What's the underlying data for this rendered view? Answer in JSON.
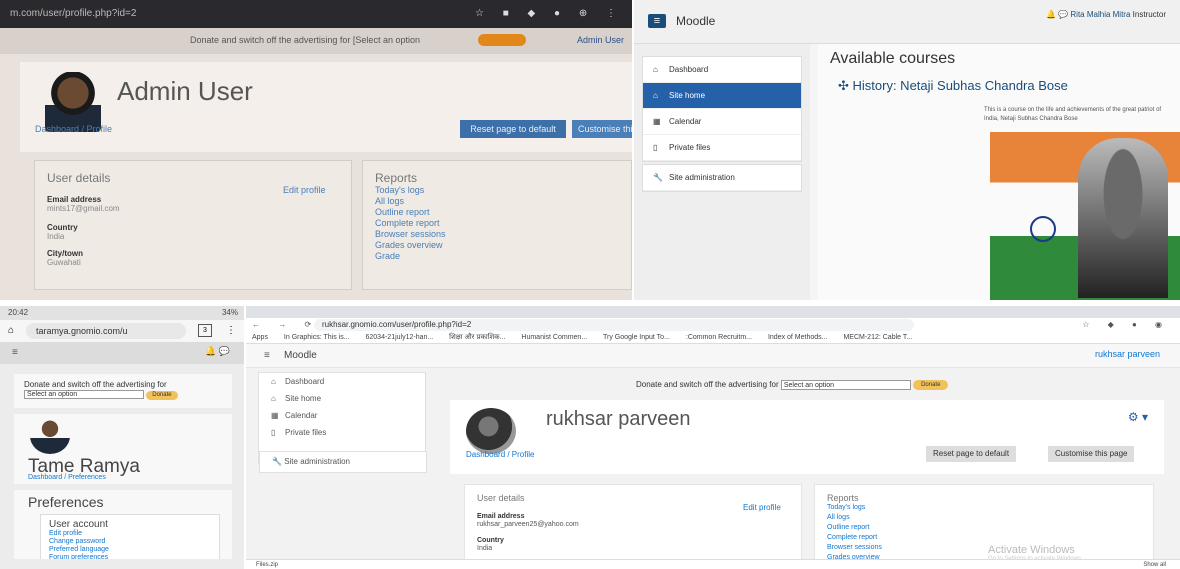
{
  "panel1": {
    "url": "m.com/user/profile.php?id=2",
    "toolbar_icons": "☆ ■ ◆ ● ⊕ ⋮",
    "donate_text": "Donate and switch off the advertising for [Select an option",
    "admin_link": "Admin User",
    "user_name": "Admin User",
    "breadcrumb": "Dashboard / Profile",
    "reset_button": "Reset page to default",
    "customise_button": "Customise this page",
    "details_heading": "User details",
    "edit_profile": "Edit profile",
    "fields": [
      {
        "label": "Email address",
        "value": "mints17@gmail.com"
      },
      {
        "label": "Country",
        "value": "India"
      },
      {
        "label": "City/town",
        "value": "Guwahati"
      }
    ],
    "reports_heading": "Reports",
    "reports": [
      "Today's logs",
      "All logs",
      "Outline report",
      "Complete report",
      "Browser sessions",
      "Grades overview",
      "Grade"
    ]
  },
  "panel2": {
    "brand": "Moodle",
    "user_name": "Rita Malhia Mitra",
    "user_role": "Instructor",
    "nav": [
      {
        "icon": "⌂",
        "label": "Dashboard",
        "active": false
      },
      {
        "icon": "⌂",
        "label": "Site home",
        "active": true
      },
      {
        "icon": "▦",
        "label": "Calendar",
        "active": false
      },
      {
        "icon": "▯",
        "label": "Private files",
        "active": false
      }
    ],
    "site_admin": "Site administration",
    "heading": "Available courses",
    "course_title": "History: Netaji Subhas Chandra Bose",
    "course_summary": "This is a course on the life and achievements of the great patriot of India, Netaji Subhas Chandra Bose"
  },
  "panel3": {
    "time": "20:42",
    "status_right": "34%",
    "url": "taramya.gnomio.com/u",
    "tab_count": "3",
    "donate_text": "Donate and switch off the advertising for",
    "select_option": "Select an option",
    "donate_button": "Donate",
    "user_name": "Tame Ramya",
    "breadcrumb": "Dashboard / Preferences",
    "prefs_heading": "Preferences",
    "account_heading": "User account",
    "links": [
      "Edit profile",
      "Change password",
      "Preferred language",
      "Forum preferences"
    ]
  },
  "panel4": {
    "url": "rukhsar.gnomio.com/user/profile.php?id=2",
    "bookmarks": [
      "Apps",
      "In Graphics: This is...",
      "62034-21july12-han...",
      "शिक्षा और प्रकाशिक...",
      "Humanist Commen...",
      "Try Google Input To...",
      ":Common Recruitm...",
      "Index of Methods...",
      "MECM-212: Cable T..."
    ],
    "brand": "Moodle",
    "user_name": "rukhsar parveen",
    "nav": [
      {
        "icon": "⌂",
        "label": "Dashboard"
      },
      {
        "icon": "⌂",
        "label": "Site home"
      },
      {
        "icon": "▦",
        "label": "Calendar"
      },
      {
        "icon": "▯",
        "label": "Private files"
      }
    ],
    "site_admin": "Site administration",
    "donate_text": "Donate and switch off the advertising for",
    "select_option": "Select an option",
    "donate_button": "Donate",
    "profile_name": "rukhsar parveen",
    "breadcrumb": "Dashboard / Profile",
    "reset_button": "Reset page to default",
    "customise_button": "Customise this page",
    "details_heading": "User details",
    "edit_profile": "Edit profile",
    "fields": [
      {
        "label": "Email address",
        "value": "rukhsar_parveen25@yahoo.com"
      },
      {
        "label": "Country",
        "value": "India"
      }
    ],
    "reports_heading": "Reports",
    "reports": [
      "Today's logs",
      "All logs",
      "Outline report",
      "Complete report",
      "Browser sessions",
      "Grades overview"
    ],
    "watermark": "Activate Windows",
    "watermark_sub": "Go to Settings to activate Windows.",
    "download_file": "Files.zip",
    "show_all": "Show all"
  }
}
